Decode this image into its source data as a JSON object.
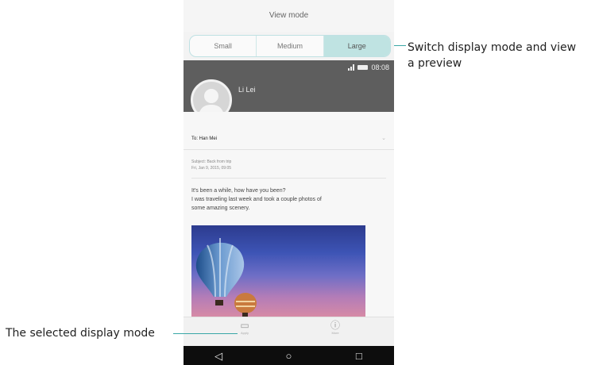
{
  "phone": {
    "title": "View mode",
    "view_modes": [
      {
        "label": "Small",
        "selected": false
      },
      {
        "label": "Medium",
        "selected": false
      },
      {
        "label": "Large",
        "selected": true
      }
    ],
    "status": {
      "time": "08:08"
    },
    "sender_name": "Li Lei",
    "to_label": "To: Han Mei",
    "subject_line": "Subject: Back from trip",
    "date_line": "Fri, Jan 9, 2015, 09:05",
    "message_line1": "It's been a while, how have you been?",
    "message_line2": "I was traveling last week and took a couple photos of",
    "message_line3": "some amazing scenery.",
    "bottom_actions": [
      {
        "label": "Apply",
        "icon": "apply-icon"
      },
      {
        "label": "More",
        "icon": "info-icon"
      }
    ],
    "nav_buttons": [
      "back-icon",
      "home-icon",
      "recents-icon"
    ]
  },
  "annotations": {
    "switch_mode_line1": "Switch display mode and view",
    "switch_mode_line2": "a preview",
    "selected_mode": "The selected display mode"
  },
  "colors": {
    "accent": "#39a7a6",
    "segment_selected": "#bfe3e2",
    "header_gray": "#5e5e5e"
  }
}
